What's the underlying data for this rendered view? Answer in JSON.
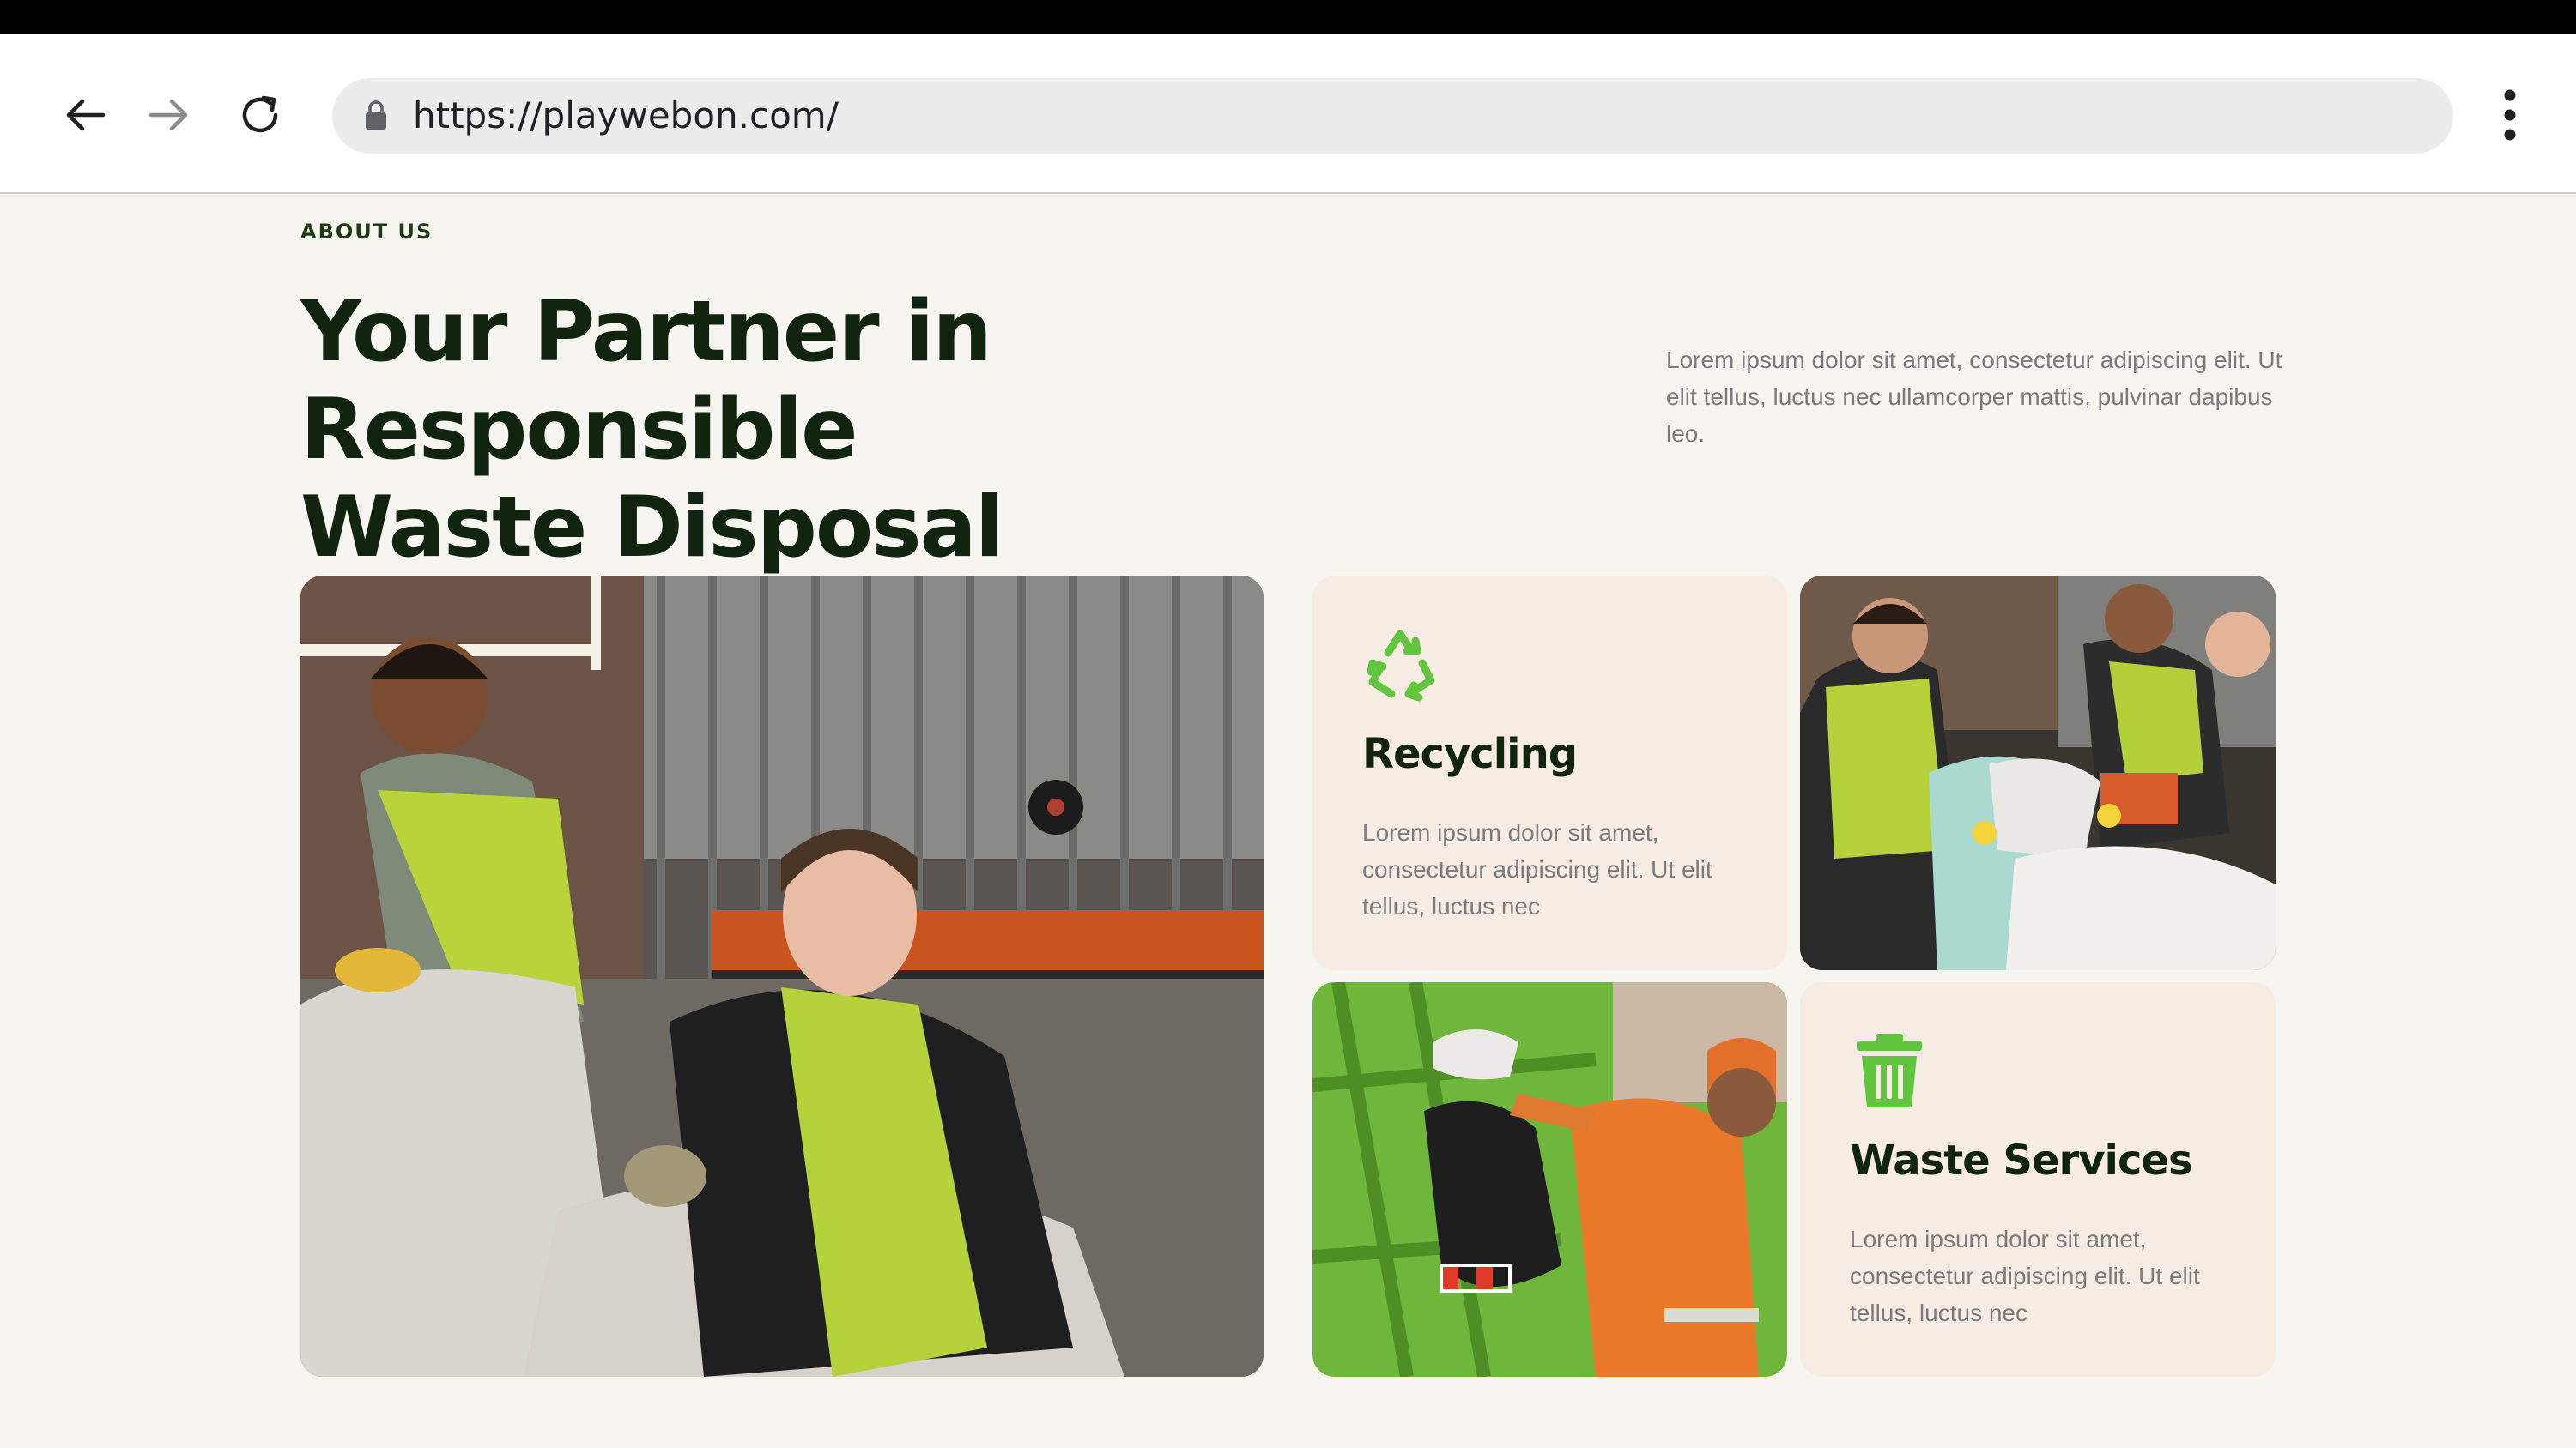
{
  "browser": {
    "url": "https://playwebon.com/",
    "icons": [
      "back-arrow-icon",
      "forward-arrow-icon",
      "reload-icon",
      "lock-icon",
      "more-vertical-icon"
    ]
  },
  "about": {
    "eyebrow": "ABOUT US",
    "title_line1": "Your Partner in Responsible",
    "title_line2": "Waste Disposal",
    "description": "Lorem ipsum dolor sit amet, consectetur adipiscing elit. Ut elit tellus, luctus nec ullamcorper mattis, pulvinar dapibus leo."
  },
  "services": [
    {
      "icon": "recycle-icon",
      "title": "Recycling",
      "text": "Lorem ipsum dolor sit amet, consectetur adipiscing elit. Ut elit tellus, luctus nec"
    },
    {
      "icon": "trash-icon",
      "title": "Waste Services",
      "text": "Lorem ipsum dolor sit amet, consectetur adipiscing elit. Ut elit tellus, luctus nec"
    }
  ],
  "colors": {
    "accent_green": "#5fc63d",
    "heading": "#112410",
    "card_bg": "#f7ece3",
    "page_bg": "#f7f5f0"
  }
}
